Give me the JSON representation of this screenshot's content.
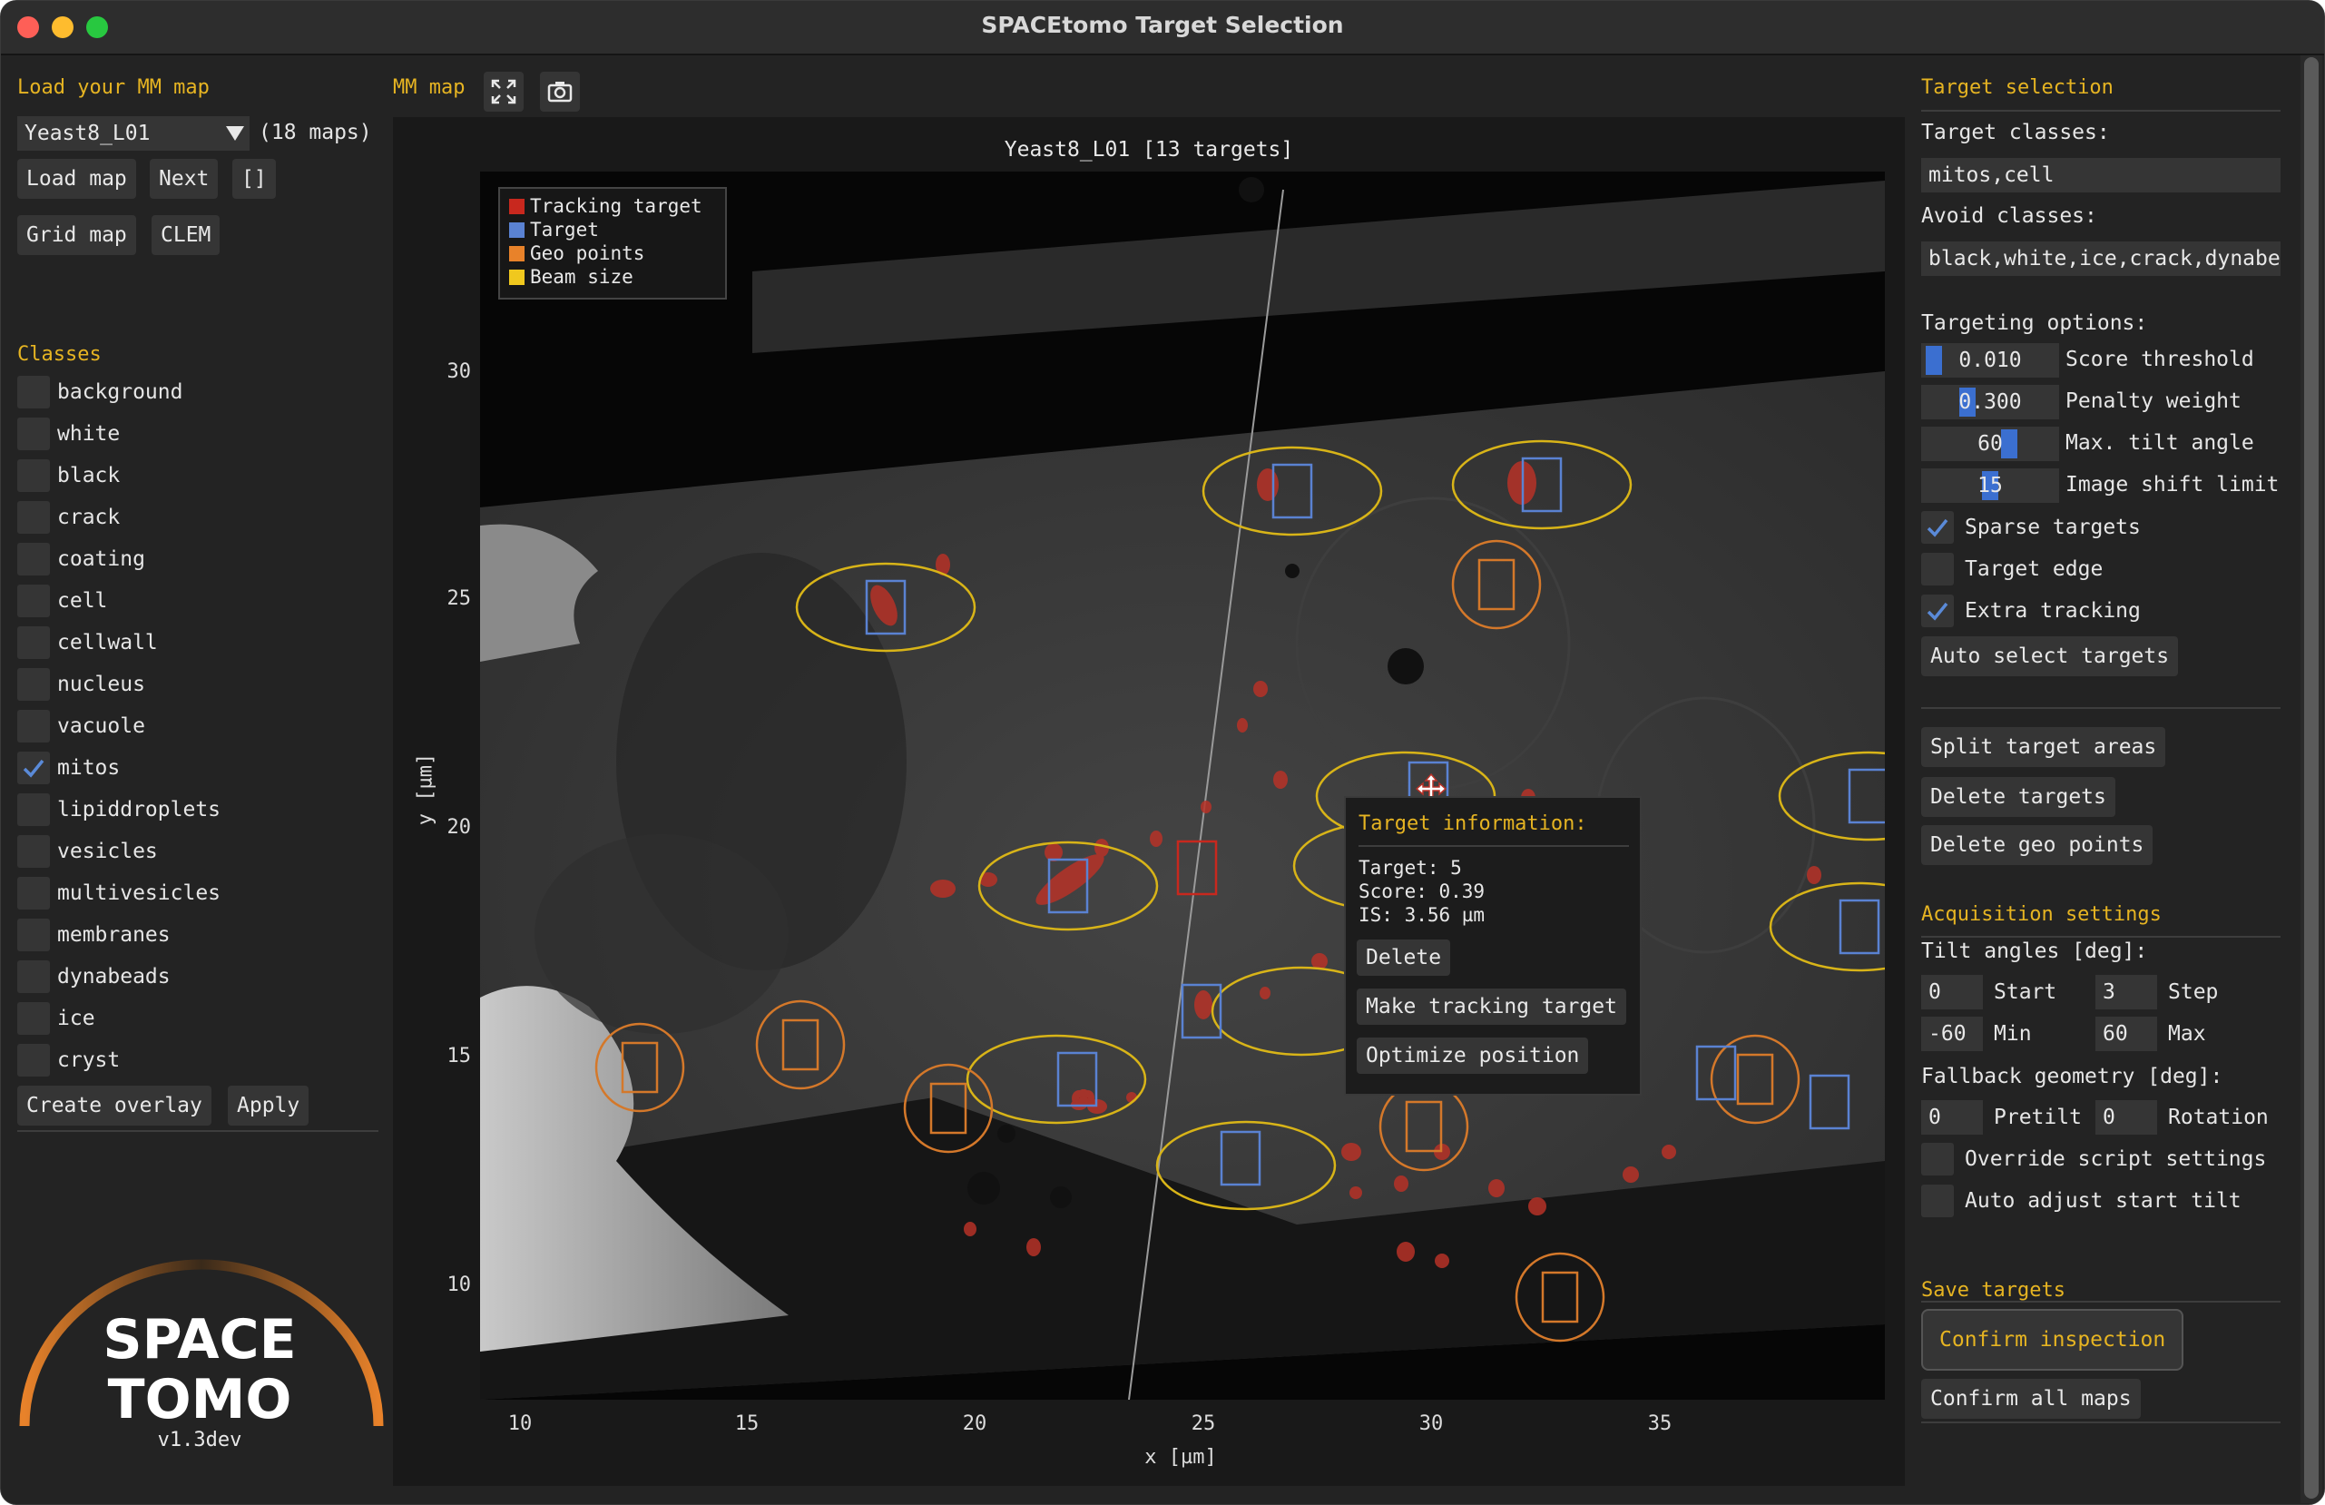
{
  "window": {
    "title": "SPACEtomo Target Selection"
  },
  "left_panel": {
    "load_header": "Load your MM map",
    "map_select": {
      "value": "Yeast8_L01",
      "count": "(18 maps)"
    },
    "buttons": {
      "load_map": "Load map",
      "next": "Next",
      "brackets": "[]",
      "grid_map": "Grid map",
      "clem": "CLEM"
    },
    "classes_header": "Classes",
    "classes": [
      {
        "label": "background",
        "checked": false
      },
      {
        "label": "white",
        "checked": false
      },
      {
        "label": "black",
        "checked": false
      },
      {
        "label": "crack",
        "checked": false
      },
      {
        "label": "coating",
        "checked": false
      },
      {
        "label": "cell",
        "checked": false
      },
      {
        "label": "cellwall",
        "checked": false
      },
      {
        "label": "nucleus",
        "checked": false
      },
      {
        "label": "vacuole",
        "checked": false
      },
      {
        "label": "mitos",
        "checked": true
      },
      {
        "label": "lipiddroplets",
        "checked": false
      },
      {
        "label": "vesicles",
        "checked": false
      },
      {
        "label": "multivesicles",
        "checked": false
      },
      {
        "label": "membranes",
        "checked": false
      },
      {
        "label": "dynabeads",
        "checked": false
      },
      {
        "label": "ice",
        "checked": false
      },
      {
        "label": "cryst",
        "checked": false
      }
    ],
    "create_overlay": "Create overlay",
    "apply": "Apply",
    "logo": {
      "line1": "SPACE",
      "line2": "TOMO",
      "version": "v1.3dev"
    }
  },
  "map": {
    "header": "MM map",
    "toolbar_icons": [
      "expand-icon",
      "camera-icon"
    ],
    "plot_title": "Yeast8_L01 [13 targets]",
    "xlabel": "x [µm]",
    "ylabel": "y [µm]",
    "x_ticks": [
      "10",
      "15",
      "20",
      "25",
      "30",
      "35"
    ],
    "y_ticks": [
      "30",
      "25",
      "20",
      "15",
      "10"
    ],
    "legend": [
      {
        "label": "Tracking target",
        "color": "#c8281e"
      },
      {
        "label": "Target",
        "color": "#5a82d2"
      },
      {
        "label": "Geo points",
        "color": "#e8822a"
      },
      {
        "label": "Beam size",
        "color": "#f0c81e"
      }
    ],
    "popup": {
      "title": "Target information:",
      "target": "Target: 5",
      "score": "Score: 0.39",
      "is": "IS: 3.56 µm",
      "buttons": {
        "delete": "Delete",
        "make_tracking": "Make tracking target",
        "optimize": "Optimize position"
      }
    }
  },
  "right_panel": {
    "target_header": "Target selection",
    "target_classes_label": "Target classes:",
    "target_classes_value": "mitos,cell",
    "avoid_classes_label": "Avoid classes:",
    "avoid_classes_value": "black,white,ice,crack,dynabeads",
    "targeting_label": "Targeting options:",
    "sliders": [
      {
        "value": "0.010",
        "label": "Score threshold",
        "fill": 0.01
      },
      {
        "value": "0.300",
        "label": "Penalty weight",
        "fill": 0.3
      },
      {
        "value": "60",
        "label": "Max. tilt angle",
        "fill": 0.67
      },
      {
        "value": "15",
        "label": "Image shift limit",
        "fill": 0.5
      }
    ],
    "options": [
      {
        "label": "Sparse targets",
        "checked": true
      },
      {
        "label": "Target edge",
        "checked": false
      },
      {
        "label": "Extra tracking",
        "checked": true
      }
    ],
    "auto_select": "Auto select targets",
    "split_areas": "Split target areas",
    "delete_targets": "Delete targets",
    "delete_geo": "Delete geo points",
    "acq_header": "Acquisition settings",
    "tilt_label": "Tilt angles [deg]:",
    "tilt": {
      "start_value": "0",
      "start_label": "Start",
      "step_value": "3",
      "step_label": "Step",
      "min_value": "-60",
      "min_label": "Min",
      "max_value": "60",
      "max_label": "Max"
    },
    "fallback_label": "Fallback geometry [deg]:",
    "fallback": {
      "pretilt_value": "0",
      "pretilt_label": "Pretilt",
      "rotation_value": "0",
      "rotation_label": "Rotation"
    },
    "override": "Override script settings",
    "auto_adjust": "Auto adjust start tilt",
    "save_header": "Save targets",
    "confirm_inspection": "Confirm inspection",
    "confirm_all": "Confirm all maps"
  }
}
